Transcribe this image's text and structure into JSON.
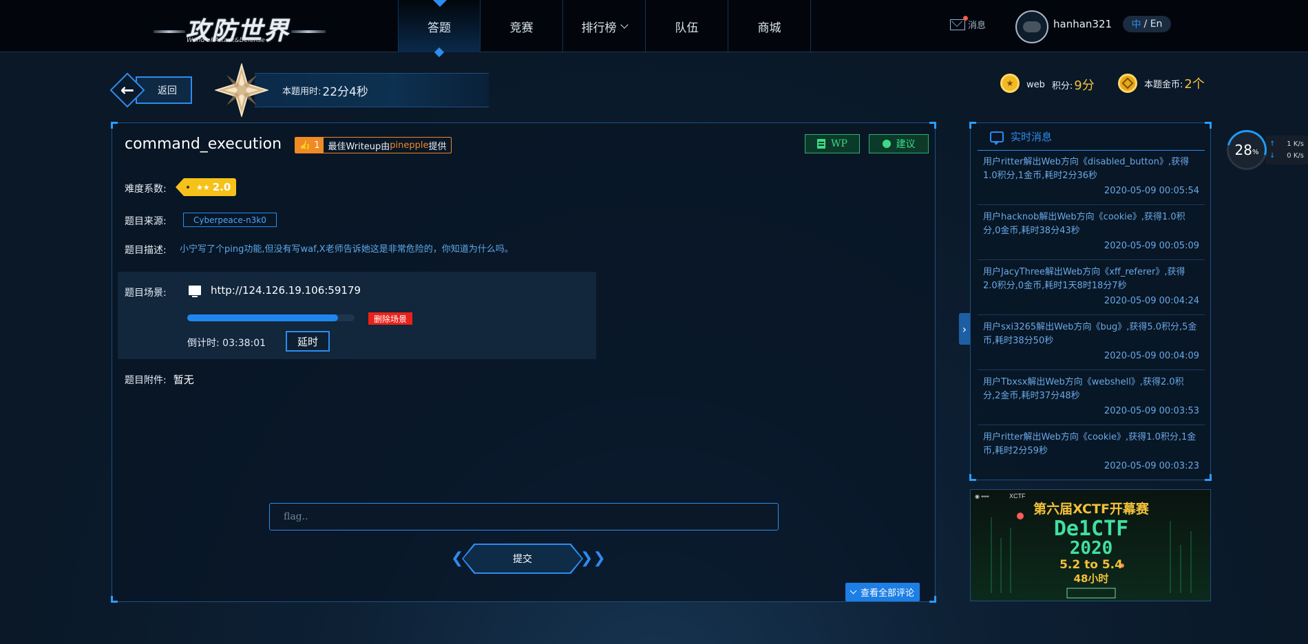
{
  "header": {
    "logo_text": "攻防世界",
    "logo_sub": "World of Attack&Defense",
    "nav": [
      {
        "label": "答题",
        "active": true
      },
      {
        "label": "竞赛"
      },
      {
        "label": "排行榜"
      },
      {
        "label": "队伍"
      },
      {
        "label": "商城"
      }
    ],
    "message_label": "消息",
    "username": "hanhan321",
    "lang_zh": "中",
    "lang_sep": "/ En"
  },
  "topbar": {
    "back_label": "返回",
    "time_label": "本题用时:",
    "time_value": "22分4秒",
    "score_category": "web",
    "score_label": "积分:",
    "score_value": "9分",
    "coins_label": "本题金币:",
    "coins_value": "2个"
  },
  "challenge": {
    "title": "command_execution",
    "writeup_count": "1",
    "writeup_prefix": "最佳Writeup由",
    "writeup_user": "pinepple",
    "writeup_suffix": "提供",
    "wp_label": "WP",
    "suggest_label": "建议",
    "difficulty_label": "难度系数:",
    "difficulty_stars": "★★",
    "difficulty_value": "2.0",
    "source_label": "题目来源:",
    "source_value": "Cyberpeace-n3k0",
    "desc_label": "题目描述:",
    "desc_value": "小宁写了个ping功能,但没有写waf,X老师告诉她这是非常危险的，你知道为什么吗。",
    "scene_label": "题目场景:",
    "scene_url": "http://124.126.19.106:59179",
    "scene_progress": 0.9,
    "delete_label": "删除场景",
    "countdown_label": "倒计时:",
    "countdown_value": "03:38:01",
    "extend_label": "延时",
    "attach_label": "题目附件:",
    "attach_value": "暂无",
    "flag_placeholder": "flag..",
    "submit_label": "提交",
    "comments_label": "查看全部评论"
  },
  "news": {
    "title": "实时消息",
    "items": [
      {
        "text": "用户ritter解出Web方向《disabled_button》,获得1.0积分,1金币,耗时2分36秒",
        "time": "2020-05-09 00:05:54"
      },
      {
        "text": "用户hacknob解出Web方向《cookie》,获得1.0积分,0金币,耗时38分43秒",
        "time": "2020-05-09 00:05:09"
      },
      {
        "text": "用户JacyThree解出Web方向《xff_referer》,获得2.0积分,0金币,耗时1天8时18分7秒",
        "time": "2020-05-09 00:04:24"
      },
      {
        "text": "用户sxi3265解出Web方向《bug》,获得5.0积分,5金币,耗时38分50秒",
        "time": "2020-05-09 00:04:09"
      },
      {
        "text": "用户Tbxsx解出Web方向《webshell》,获得2.0积分,2金币,耗时37分48秒",
        "time": "2020-05-09 00:03:53"
      },
      {
        "text": "用户ritter解出Web方向《cookie》,获得1.0积分,1金币,耗时2分59秒",
        "time": "2020-05-09 00:03:23"
      }
    ]
  },
  "banner": {
    "headline": "第六届XCTF开幕赛",
    "name": "De1CTF",
    "year": "2020",
    "dates": "5.2 to 5.4",
    "duration": "48小时",
    "brand_right": "XCTF"
  },
  "speed": {
    "percent": "28",
    "percent_unit": "%",
    "up": "1",
    "up_unit": "K/s",
    "down": "0",
    "down_unit": "K/s"
  },
  "colors": {
    "accent": "#2d8cf0",
    "gold": "#f6c33d",
    "danger": "#e8221b",
    "green": "#3ddc84"
  }
}
